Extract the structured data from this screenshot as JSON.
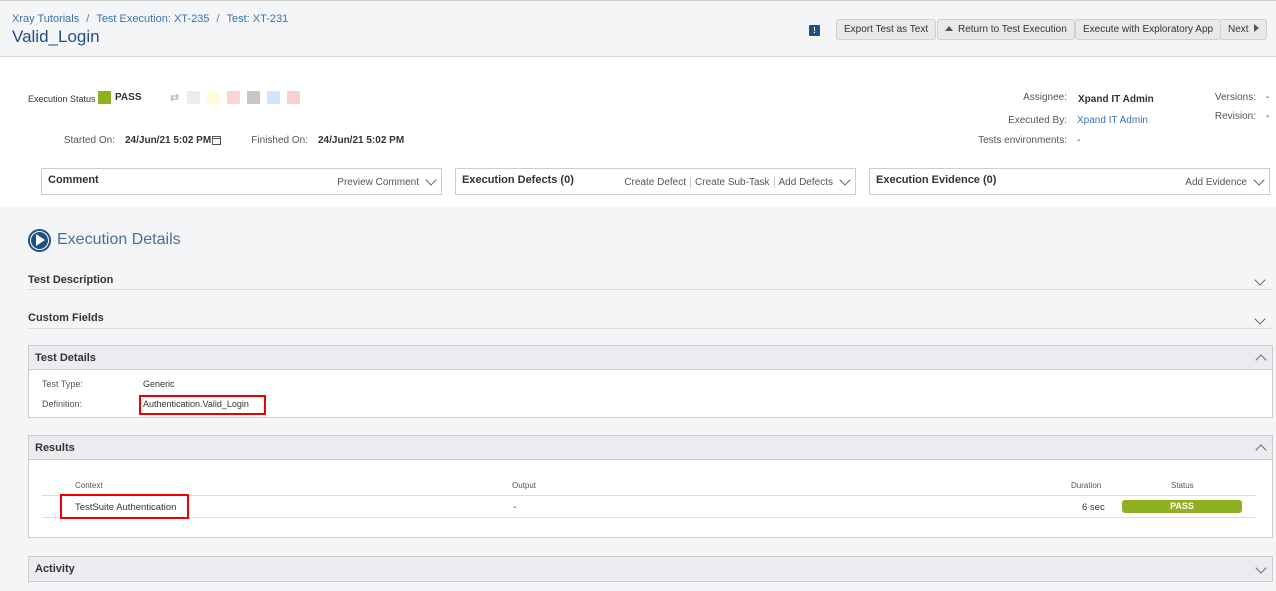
{
  "breadcrumb": {
    "items": [
      "Xray Tutorials",
      "Test Execution: XT-235",
      "Test: XT-231"
    ],
    "separator": "/"
  },
  "page_title": "Valid_Login",
  "toolbar": {
    "export_label": "Export Test as Text",
    "return_label": "Return to Test Execution",
    "exploratory_label": "Execute with Exploratory App",
    "next_label": "Next",
    "feedback_icon": "!"
  },
  "execution": {
    "status_label": "Execution Status",
    "status_value": "PASS",
    "status_color": "#8eb021",
    "status_options_colors": [
      "#ebecf0",
      "#fffbdb",
      "#f9d5d5",
      "#c6c6c6",
      "#d2e4fc",
      "#f7d1d1"
    ],
    "started_label": "Started On:",
    "started_value": "24/Jun/21 5:02 PM",
    "finished_label": "Finished On:",
    "finished_value": "24/Jun/21 5:02 PM",
    "assignee_label": "Assignee:",
    "assignee_value": "Xpand IT Admin",
    "executed_by_label": "Executed By:",
    "executed_by_value": "Xpand IT Admin",
    "environments_label": "Tests environments:",
    "environments_value": "-",
    "versions_label": "Versions:",
    "versions_value": "-",
    "revision_label": "Revision:",
    "revision_value": "-"
  },
  "boxes": {
    "comment": {
      "title": "Comment",
      "actions": [
        "Preview Comment"
      ]
    },
    "defects": {
      "title": "Execution Defects (0)",
      "actions": [
        "Create Defect",
        "Create Sub-Task",
        "Add Defects"
      ]
    },
    "evidence": {
      "title": "Execution Evidence (0)",
      "actions": [
        "Add Evidence"
      ]
    }
  },
  "details": {
    "title": "Execution Details",
    "test_description": "Test Description",
    "custom_fields": "Custom Fields",
    "test_details": {
      "title": "Test Details",
      "type_label": "Test Type:",
      "type_value": "Generic",
      "definition_label": "Definition:",
      "definition_value": "Authentication.Valid_Login"
    },
    "results": {
      "title": "Results",
      "columns": [
        "Context",
        "Output",
        "Duration",
        "Status"
      ],
      "rows": [
        {
          "context": "TestSuite Authentication",
          "output": "-",
          "duration": "6 sec",
          "status": "PASS"
        }
      ]
    },
    "activity": "Activity"
  }
}
